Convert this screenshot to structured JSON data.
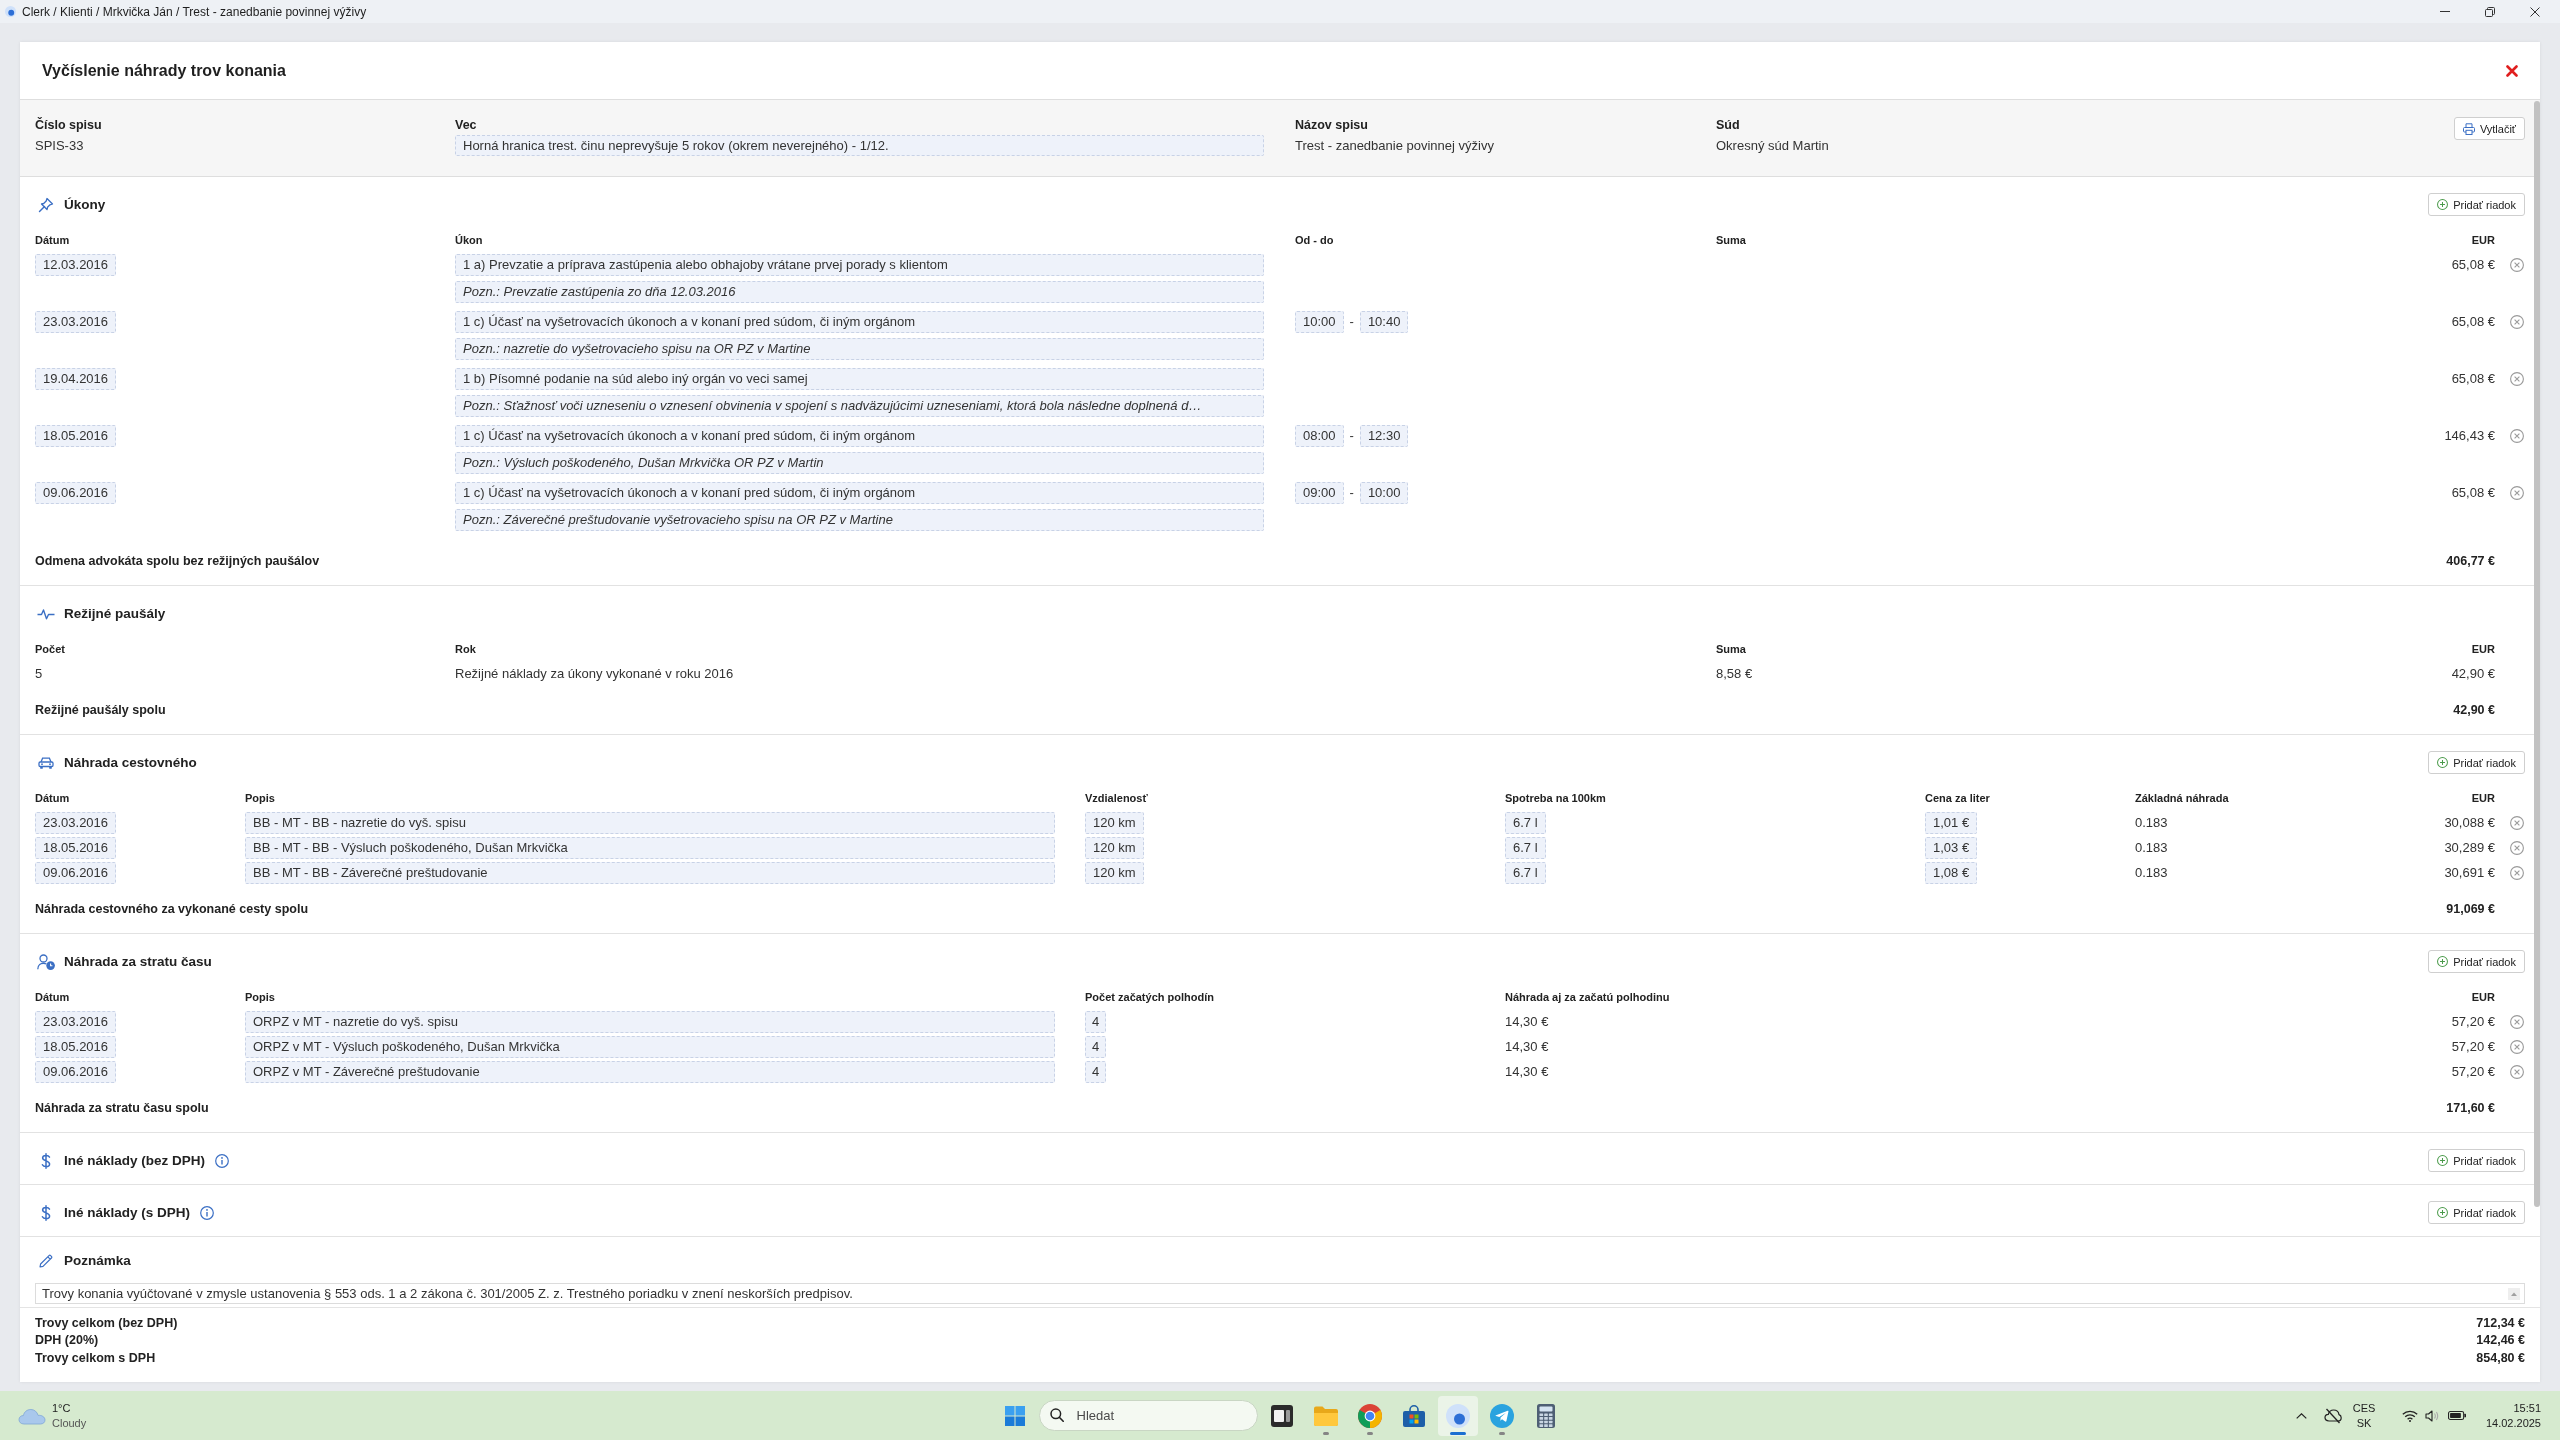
{
  "window": {
    "title": "Clerk / Klienti / Mrkvička Ján / Trest - zanedbanie povinnej výživy"
  },
  "dialog": {
    "title": "Vyčíslenie náhrady trov konania"
  },
  "case_info": {
    "fields": [
      {
        "kind": "text",
        "label": "Číslo spisu",
        "value": "SPIS-33"
      },
      {
        "kind": "field",
        "label": "Vec",
        "value": "Horná hranica trest. činu neprevyšuje 5 rokov (okrem neverejného) - 1/12."
      },
      {
        "kind": "text",
        "label": "Názov spisu",
        "value": "Trest - zanedbanie povinnej výživy"
      },
      {
        "kind": "text",
        "label": "Súd",
        "value": "Okresný súd Martin"
      }
    ],
    "print_button": "Vytlačiť"
  },
  "acts": {
    "title": "Úkony",
    "add_button": "Pridať riadok",
    "columns": [
      "Dátum",
      "Úkon",
      "Od - do",
      "Suma",
      "EUR"
    ],
    "rows": [
      {
        "date": "12.03.2016",
        "act": "1 a) Prevzatie a príprava zastúpenia alebo obhajoby vrátane prvej porady s klientom",
        "note": "Pozn.: Prevzatie zastúpenia zo dňa 12.03.2016",
        "amount": "65,08 €"
      },
      {
        "date": "23.03.2016",
        "act": "1 c) Účasť na vyšetrovacích úkonoch a v konaní pred súdom, či iným orgánom",
        "note": "Pozn.: nazretie do vyšetrovacieho spisu na OR PZ v Martine",
        "time_from": "10:00",
        "time_separator": "-",
        "time_to": "10:40",
        "amount": "65,08 €"
      },
      {
        "date": "19.04.2016",
        "act": "1 b) Písomné podanie na súd alebo iný orgán vo veci samej",
        "note": "Pozn.: Sťažnosť voči uzneseniu o vznesení obvinenia v spojení s nadväzujúcimi uzneseniami, ktorá bola následne doplnená d…",
        "amount": "65,08 €"
      },
      {
        "date": "18.05.2016",
        "act": "1 c) Účasť na vyšetrovacích úkonoch a v konaní pred súdom, či iným orgánom",
        "note": "Pozn.: Výsluch poškodeného, Dušan Mrkvička OR PZ v Martin",
        "time_from": "08:00",
        "time_separator": "-",
        "time_to": "12:30",
        "amount": "146,43 €"
      },
      {
        "date": "09.06.2016",
        "act": "1 c) Účasť na vyšetrovacích úkonoch a v konaní pred súdom, či iným orgánom",
        "note": "Pozn.: Záverečné preštudovanie vyšetrovacieho spisu na OR PZ v Martine",
        "time_from": "09:00",
        "time_separator": "-",
        "time_to": "10:00",
        "amount": "65,08 €"
      }
    ],
    "total_label": "Odmena advokáta spolu bez režijných paušálov",
    "total": "406,77 €"
  },
  "overhead": {
    "title": "Režijné paušály",
    "columns": [
      "Počet",
      "Rok",
      "Suma",
      "EUR"
    ],
    "rows": [
      {
        "count": "5",
        "year": "Režijné náklady za úkony vykonané v roku 2016",
        "sum": "8,58 €",
        "amount": "42,90 €"
      }
    ],
    "total_label": "Režijné paušály spolu",
    "total": "42,90 €"
  },
  "travel": {
    "title": "Náhrada cestovného",
    "add_button": "Pridať riadok",
    "columns": [
      "Dátum",
      "Popis",
      "Vzdialenosť",
      "Spotreba na 100km",
      "Cena za liter",
      "Základná náhrada",
      "EUR"
    ],
    "rows": [
      {
        "date": "23.03.2016",
        "description": "BB - MT - BB - nazretie do vyš. spisu",
        "distance": "120 km",
        "consumption": "6.7 l",
        "price": "1,01 €",
        "base_rate": "0.183",
        "amount": "30,088 €"
      },
      {
        "date": "18.05.2016",
        "description": "BB - MT - BB - Výsluch poškodeného, Dušan Mrkvička",
        "distance": "120 km",
        "consumption": "6.7 l",
        "price": "1,03 €",
        "base_rate": "0.183",
        "amount": "30,289 €"
      },
      {
        "date": "09.06.2016",
        "description": "BB - MT - BB - Záverečné preštudovanie",
        "distance": "120 km",
        "consumption": "6.7 l",
        "price": "1,08 €",
        "base_rate": "0.183",
        "amount": "30,691 €"
      }
    ],
    "total_label": "Náhrada cestovného za vykonané cesty spolu",
    "total": "91,069 €"
  },
  "time_loss": {
    "title": "Náhrada za stratu času",
    "add_button": "Pridať riadok",
    "columns": [
      "Dátum",
      "Popis",
      "Počet začatých polhodín",
      "Náhrada aj za začatú polhodinu",
      "EUR"
    ],
    "rows": [
      {
        "date": "23.03.2016",
        "description": "ORPZ v MT - nazretie do vyš. spisu",
        "half_hours": "4",
        "rate": "14,30 €",
        "amount": "57,20 €"
      },
      {
        "date": "18.05.2016",
        "description": "ORPZ v MT - Výsluch poškodeného, Dušan Mrkvička",
        "half_hours": "4",
        "rate": "14,30 €",
        "amount": "57,20 €"
      },
      {
        "date": "09.06.2016",
        "description": "ORPZ v MT - Záverečné preštudovanie",
        "half_hours": "4",
        "rate": "14,30 €",
        "amount": "57,20 €"
      }
    ],
    "total_label": "Náhrada za stratu času spolu",
    "total": "171,60 €"
  },
  "other_costs": [
    {
      "title": "Iné náklady (bez DPH)",
      "add_button": "Pridať riadok"
    },
    {
      "title": "Iné náklady (s DPH)",
      "add_button": "Pridať riadok"
    }
  ],
  "note": {
    "title": "Poznámka",
    "value": "Trovy konania vyúčtované v zmysle ustanovenia § 553 ods. 1 a 2 zákona č. 301/2005 Z. z. Trestného poriadku v znení neskorších predpisov."
  },
  "totals": [
    {
      "label": "Trovy celkom (bez DPH)",
      "value": "712,34 €"
    },
    {
      "label": "DPH (20%)",
      "value": "142,46 €"
    },
    {
      "label": "Trovy celkom s DPH",
      "value": "854,80 €"
    }
  ],
  "taskbar": {
    "weather": {
      "temperature": "1°C",
      "condition": "Cloudy"
    },
    "search": {
      "placeholder": "Hledat"
    },
    "apps": [
      {
        "kind": "task_view",
        "running": false,
        "selected": false
      },
      {
        "kind": "files",
        "running": true,
        "selected": false
      },
      {
        "kind": "browser",
        "running": true,
        "selected": false
      },
      {
        "kind": "store",
        "running": false,
        "selected": false
      },
      {
        "kind": "clerk",
        "running": true,
        "selected": true
      },
      {
        "kind": "messenger",
        "running": true,
        "selected": false
      },
      {
        "kind": "calculator",
        "running": false,
        "selected": false
      }
    ],
    "tray": {
      "language": "CES",
      "layout": "SK",
      "time": "15:51",
      "date": "14.02.2025"
    }
  }
}
